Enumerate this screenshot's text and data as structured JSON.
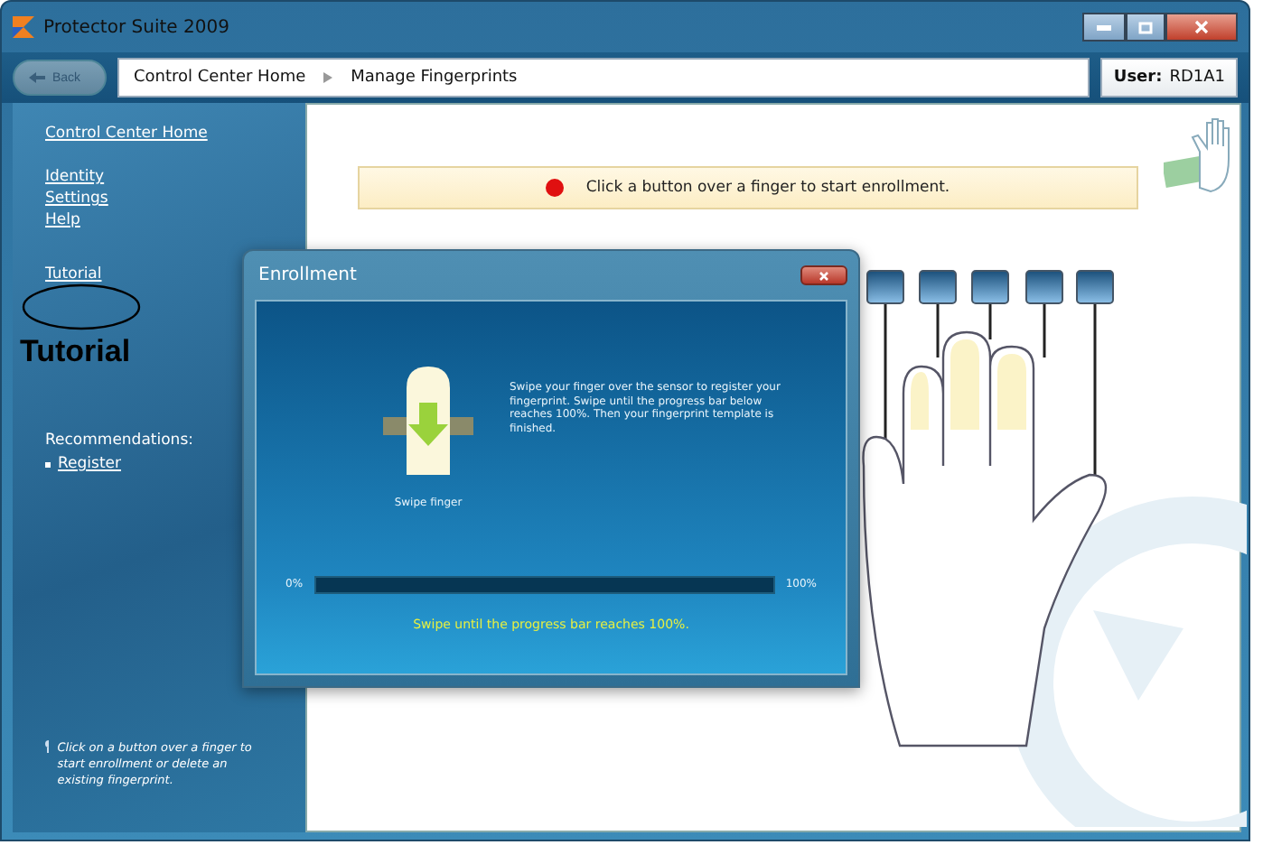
{
  "window": {
    "title": "Protector Suite 2009"
  },
  "nav": {
    "back": {
      "label": "Back",
      "disabled": true
    },
    "breadcrumbs": [
      "Control Center Home",
      "Manage Fingerprints"
    ],
    "user_label": "User:",
    "user": "RD1A1"
  },
  "sidebar": {
    "home_link": "Control Center Home",
    "links": [
      "Identity",
      "Settings",
      "Help"
    ],
    "tutorial": "Tutorial",
    "recommendations_title": "Recommendations:",
    "recommendations": [
      "Register"
    ],
    "hint": "Click on a button over a finger to start enrollment or delete an existing fingerprint."
  },
  "banner": {
    "text": "Click a button over a finger to start enrollment."
  },
  "dialog": {
    "title": "Enrollment",
    "instruction": "Swipe your finger over the sensor to register your fingerprint.  Swipe until the progress bar below reaches 100%.  Then your fingerprint template is finished.",
    "icon_caption": "Swipe finger",
    "progress": {
      "level": 0,
      "min_label": "0%",
      "max_label": "100%"
    },
    "status": "Swipe until the progress bar reaches 100%."
  },
  "annotation": {
    "text": "Tutorial"
  }
}
